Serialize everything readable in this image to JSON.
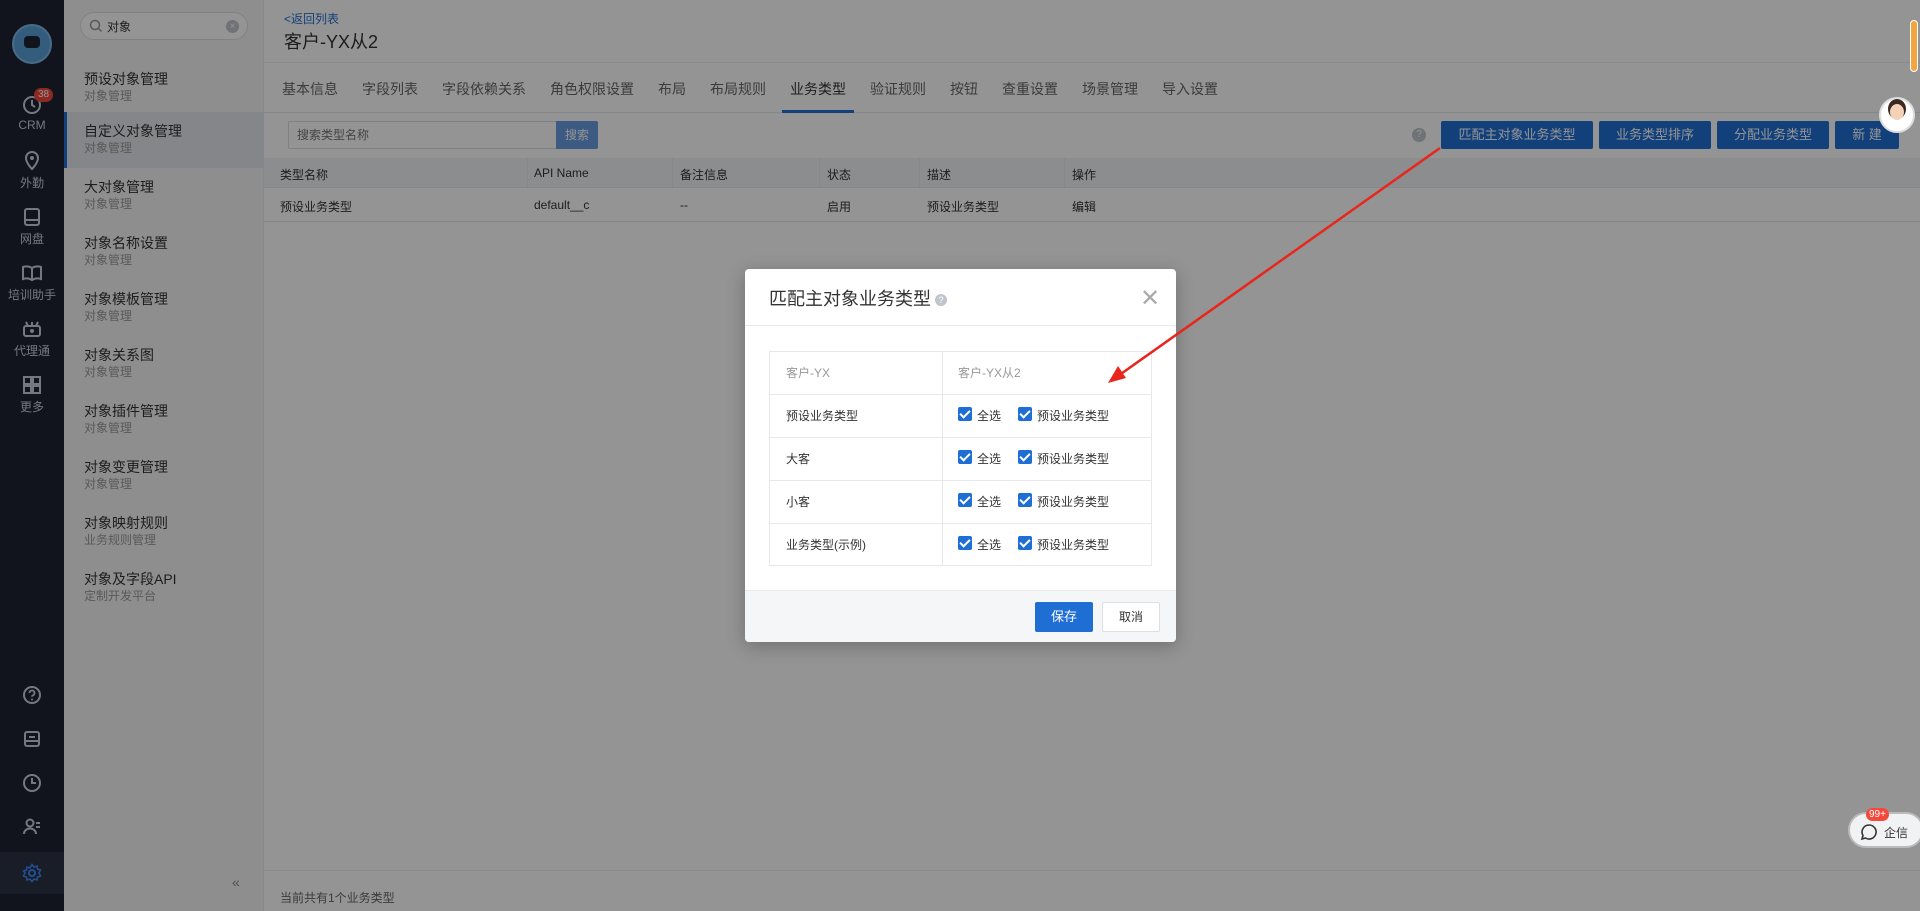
{
  "rail": {
    "items": [
      {
        "label": "CRM",
        "badge": "38"
      },
      {
        "label": "外勤"
      },
      {
        "label": "网盘"
      },
      {
        "label": "培训助手"
      },
      {
        "label": "代理通"
      },
      {
        "label": "更多"
      }
    ]
  },
  "sidebar": {
    "search_value": "对象",
    "items": [
      {
        "title": "预设对象管理",
        "sub": "对象管理"
      },
      {
        "title": "自定义对象管理",
        "sub": "对象管理"
      },
      {
        "title": "大对象管理",
        "sub": "对象管理"
      },
      {
        "title": "对象名称设置",
        "sub": "对象管理"
      },
      {
        "title": "对象模板管理",
        "sub": "对象管理"
      },
      {
        "title": "对象关系图",
        "sub": "对象管理"
      },
      {
        "title": "对象插件管理",
        "sub": "对象管理"
      },
      {
        "title": "对象变更管理",
        "sub": "对象管理"
      },
      {
        "title": "对象映射规则",
        "sub": "业务规则管理"
      },
      {
        "title": "对象及字段API",
        "sub": "定制开发平台"
      }
    ],
    "collapse_label": "«"
  },
  "header": {
    "back": "<返回列表",
    "title": "客户-YX从2"
  },
  "tabs": [
    "基本信息",
    "字段列表",
    "字段依赖关系",
    "角色权限设置",
    "布局",
    "布局规则",
    "业务类型",
    "验证规则",
    "按钮",
    "查重设置",
    "场景管理",
    "导入设置"
  ],
  "toolbar": {
    "search_placeholder": "搜索类型名称",
    "search_btn": "搜索",
    "buttons": [
      "匹配主对象业务类型",
      "业务类型排序",
      "分配业务类型",
      "新 建"
    ]
  },
  "table": {
    "columns": [
      "类型名称",
      "API Name",
      "备注信息",
      "状态",
      "描述",
      "操作"
    ],
    "rows": [
      [
        "预设业务类型",
        "default__c",
        "--",
        "启用",
        "预设业务类型",
        "编辑"
      ]
    ]
  },
  "footer": "当前共有1个业务类型",
  "dialog": {
    "title": "匹配主对象业务类型",
    "col_left": "客户-YX",
    "col_right": "客户-YX从2",
    "rows": [
      {
        "label": "预设业务类型",
        "select_all": "全选",
        "option": "预设业务类型"
      },
      {
        "label": "大客",
        "select_all": "全选",
        "option": "预设业务类型"
      },
      {
        "label": "小客",
        "select_all": "全选",
        "option": "预设业务类型"
      },
      {
        "label": "业务类型(示例)",
        "select_all": "全选",
        "option": "预设业务类型"
      }
    ],
    "save": "保存",
    "cancel": "取消"
  },
  "floating": {
    "qixin_label": "企信",
    "qixin_badge": "99+"
  },
  "colors": {
    "primary": "#1f6ed4",
    "rail_bg": "#1e2432",
    "annotation_arrow": "#e8261c"
  }
}
